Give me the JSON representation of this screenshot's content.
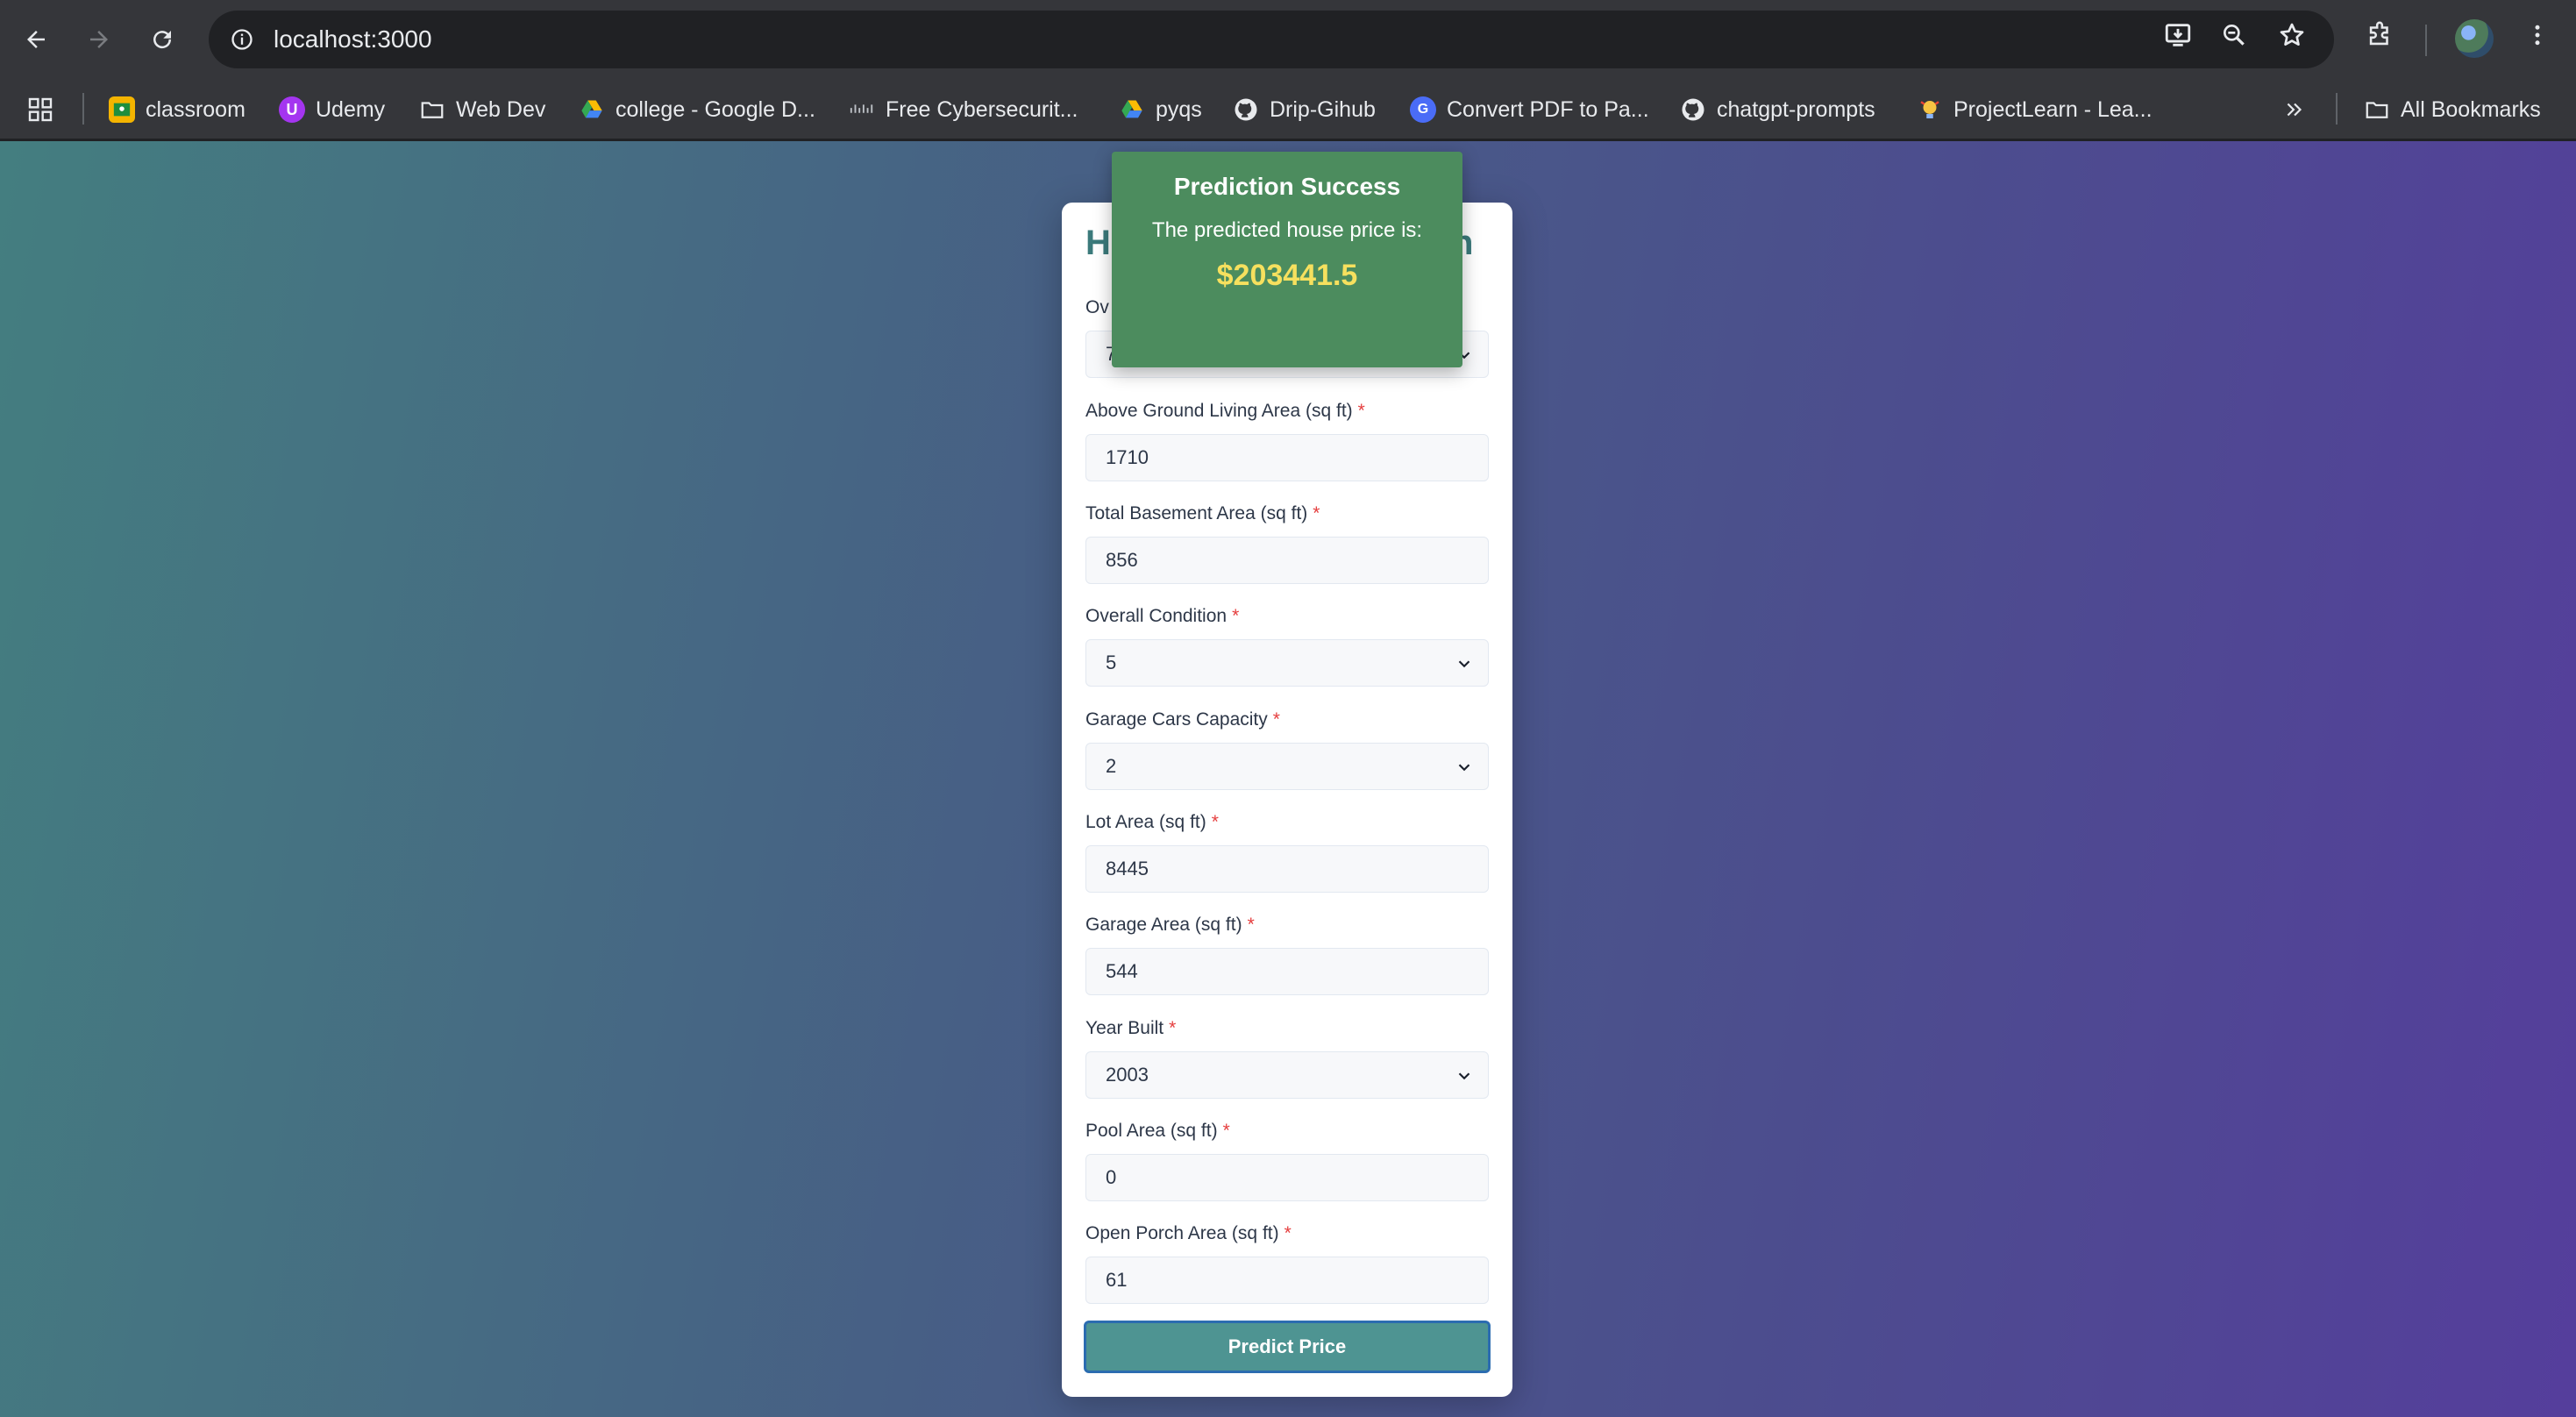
{
  "browser": {
    "url": "localhost:3000"
  },
  "bookmarks": {
    "items": [
      {
        "label": "classroom",
        "icon": "google-classroom-icon"
      },
      {
        "label": "Udemy",
        "icon": "udemy-icon"
      },
      {
        "label": "Web Dev",
        "icon": "folder-icon"
      },
      {
        "label": "college - Google D...",
        "icon": "google-drive-icon"
      },
      {
        "label": "Free Cybersecurit...",
        "icon": "cisco-icon"
      },
      {
        "label": "pyqs",
        "icon": "google-drive-icon"
      },
      {
        "label": "Drip-Gihub",
        "icon": "github-icon"
      },
      {
        "label": "Convert PDF to Pa...",
        "icon": "converter-icon"
      },
      {
        "label": "chatgpt-prompts",
        "icon": "github-icon"
      },
      {
        "label": "ProjectLearn - Lea...",
        "icon": "projectlearn-icon"
      }
    ],
    "all_bookmarks": "All Bookmarks"
  },
  "form": {
    "title_start": "H",
    "title_end": "n",
    "fields": [
      {
        "label": "Ov",
        "value": "7",
        "type": "select"
      },
      {
        "label": "Above Ground Living Area (sq ft)",
        "value": "1710",
        "type": "input"
      },
      {
        "label": "Total Basement Area (sq ft)",
        "value": "856",
        "type": "input"
      },
      {
        "label": "Overall Condition",
        "value": "5",
        "type": "select"
      },
      {
        "label": "Garage Cars Capacity",
        "value": "2",
        "type": "select"
      },
      {
        "label": "Lot Area (sq ft)",
        "value": "8445",
        "type": "input"
      },
      {
        "label": "Garage Area (sq ft)",
        "value": "544",
        "type": "input"
      },
      {
        "label": "Year Built",
        "value": "2003",
        "type": "select"
      },
      {
        "label": "Pool Area (sq ft)",
        "value": "0",
        "type": "input"
      },
      {
        "label": "Open Porch Area (sq ft)",
        "value": "61",
        "type": "input"
      }
    ],
    "required_mark": "*",
    "submit_label": "Predict Price"
  },
  "toast": {
    "title": "Prediction Success",
    "message": "The predicted house price is:",
    "price": "$203441.5"
  },
  "colors": {
    "accent": "#4e9492",
    "toast_bg": "#4c8c5e",
    "price": "#f6e05e",
    "required": "#e53e3e"
  }
}
